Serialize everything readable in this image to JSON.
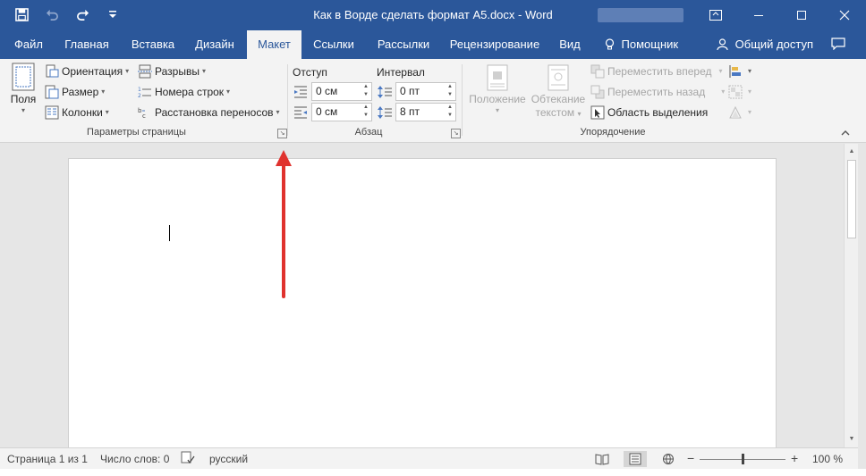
{
  "window": {
    "title": "Как в Ворде сделать формат А5.docx - Word",
    "controls": [
      "ribbon-display",
      "minimize",
      "maximize",
      "close"
    ]
  },
  "qat": {
    "icons": [
      "save-icon",
      "undo-icon",
      "redo-icon",
      "customize-icon"
    ]
  },
  "tabs": [
    {
      "label": "Файл"
    },
    {
      "label": "Главная"
    },
    {
      "label": "Вставка"
    },
    {
      "label": "Дизайн"
    },
    {
      "label": "Макет",
      "active": true
    },
    {
      "label": "Ссылки"
    },
    {
      "label": "Рассылки"
    },
    {
      "label": "Рецензирование"
    },
    {
      "label": "Вид"
    },
    {
      "label": "Помощник"
    },
    {
      "label": "Общий доступ"
    }
  ],
  "ribbon": {
    "page_setup": {
      "group_label": "Параметры страницы",
      "margins": "Поля",
      "orientation": "Ориентация",
      "size": "Размер",
      "columns": "Колонки",
      "breaks": "Разрывы",
      "line_numbers": "Номера строк",
      "hyphenation": "Расстановка переносов"
    },
    "paragraph": {
      "group_label": "Абзац",
      "indent_label": "Отступ",
      "spacing_label": "Интервал",
      "indent_left": "0 см",
      "indent_right": "0 см",
      "spacing_before": "0 пт",
      "spacing_after": "8 пт"
    },
    "arrange": {
      "group_label": "Упорядочение",
      "position": "Положение",
      "wrap_text_1": "Обтекание",
      "wrap_text_2": "текстом",
      "bring_forward": "Переместить вперед",
      "send_backward": "Переместить назад",
      "selection_pane": "Область выделения"
    }
  },
  "status": {
    "page": "Страница 1 из 1",
    "words": "Число слов: 0",
    "language": "русский",
    "zoom": "100 %",
    "zoom_level": 1.0
  },
  "colors": {
    "brand": "#2b579a",
    "annotation": "#e0322e"
  }
}
